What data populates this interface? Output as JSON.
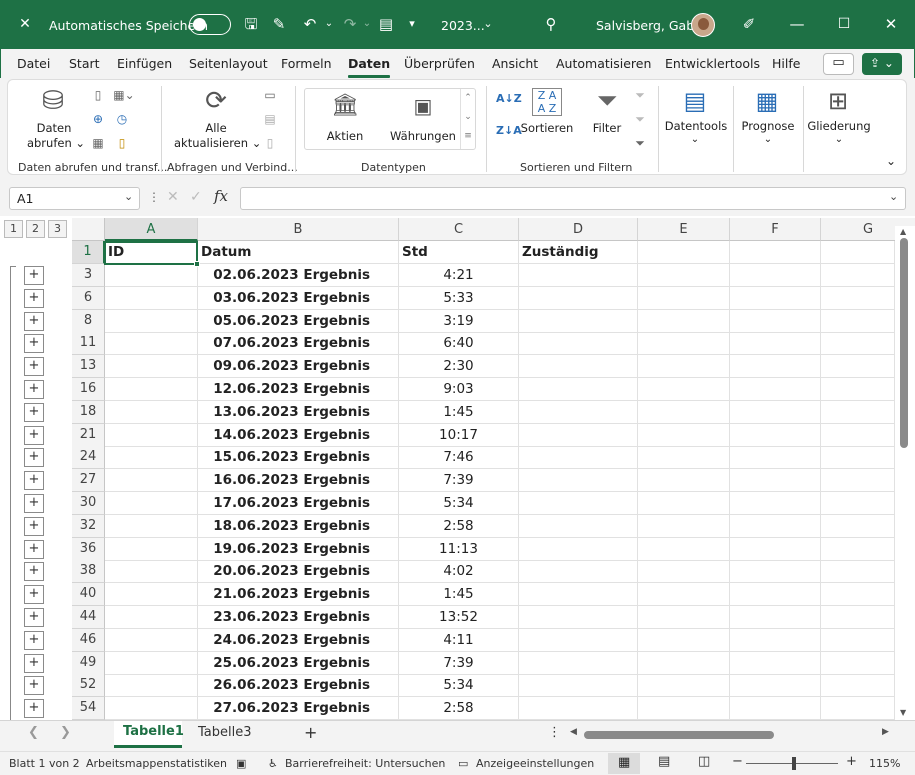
{
  "titlebar": {
    "autosave_label": "Automatisches Speichern",
    "filename": "2023...",
    "user": "Salvisberg, Gaby"
  },
  "menu": [
    "Datei",
    "Start",
    "Einfügen",
    "Seitenlayout",
    "Formeln",
    "Daten",
    "Überprüfen",
    "Ansicht",
    "Automatisieren",
    "Entwicklertools",
    "Hilfe"
  ],
  "ribbon": {
    "daten_abrufen_1": "Daten",
    "daten_abrufen_2": "abrufen",
    "alle_1": "Alle",
    "alle_2": "aktualisieren",
    "aktien": "Aktien",
    "waehrungen": "Währungen",
    "sortieren": "Sortieren",
    "filter": "Filter",
    "datentools": "Datentools",
    "prognose": "Prognose",
    "gliederung": "Gliederung",
    "groups": {
      "g1": "Daten abrufen und transf...",
      "g2": "Abfragen und Verbind...",
      "g3": "Datentypen",
      "g4": "Sortieren und Filtern"
    }
  },
  "formula": {
    "namebox": "A1",
    "value": ""
  },
  "outline_levels": [
    "1",
    "2",
    "3"
  ],
  "columns": [
    "A",
    "B",
    "C",
    "D",
    "E",
    "F",
    "G"
  ],
  "headers": {
    "row": "1",
    "id": "ID",
    "datum": "Datum",
    "std": "Std",
    "zustaendig": "Zuständig"
  },
  "rows": [
    {
      "n": "3",
      "datum": "02.06.2023 Ergebnis",
      "std": "4:21"
    },
    {
      "n": "6",
      "datum": "03.06.2023 Ergebnis",
      "std": "5:33"
    },
    {
      "n": "8",
      "datum": "05.06.2023 Ergebnis",
      "std": "3:19"
    },
    {
      "n": "11",
      "datum": "07.06.2023 Ergebnis",
      "std": "6:40"
    },
    {
      "n": "13",
      "datum": "09.06.2023 Ergebnis",
      "std": "2:30"
    },
    {
      "n": "16",
      "datum": "12.06.2023 Ergebnis",
      "std": "9:03"
    },
    {
      "n": "18",
      "datum": "13.06.2023 Ergebnis",
      "std": "1:45"
    },
    {
      "n": "21",
      "datum": "14.06.2023 Ergebnis",
      "std": "10:17"
    },
    {
      "n": "24",
      "datum": "15.06.2023 Ergebnis",
      "std": "7:46"
    },
    {
      "n": "27",
      "datum": "16.06.2023 Ergebnis",
      "std": "7:39"
    },
    {
      "n": "30",
      "datum": "17.06.2023 Ergebnis",
      "std": "5:34"
    },
    {
      "n": "32",
      "datum": "18.06.2023 Ergebnis",
      "std": "2:58"
    },
    {
      "n": "36",
      "datum": "19.06.2023 Ergebnis",
      "std": "11:13"
    },
    {
      "n": "38",
      "datum": "20.06.2023 Ergebnis",
      "std": "4:02"
    },
    {
      "n": "40",
      "datum": "21.06.2023 Ergebnis",
      "std": "1:45"
    },
    {
      "n": "44",
      "datum": "23.06.2023 Ergebnis",
      "std": "13:52"
    },
    {
      "n": "46",
      "datum": "24.06.2023 Ergebnis",
      "std": "4:11"
    },
    {
      "n": "49",
      "datum": "25.06.2023 Ergebnis",
      "std": "7:39"
    },
    {
      "n": "52",
      "datum": "26.06.2023 Ergebnis",
      "std": "5:34"
    },
    {
      "n": "54",
      "datum": "27.06.2023 Ergebnis",
      "std": "2:58"
    }
  ],
  "sheets": [
    "Tabelle1",
    "Tabelle3"
  ],
  "status": {
    "page": "Blatt 1 von 2",
    "stats": "Arbeitsmappenstatistiken",
    "access": "Barrierefreiheit: Untersuchen",
    "display": "Anzeigeeinstellungen",
    "zoom": "115%"
  }
}
